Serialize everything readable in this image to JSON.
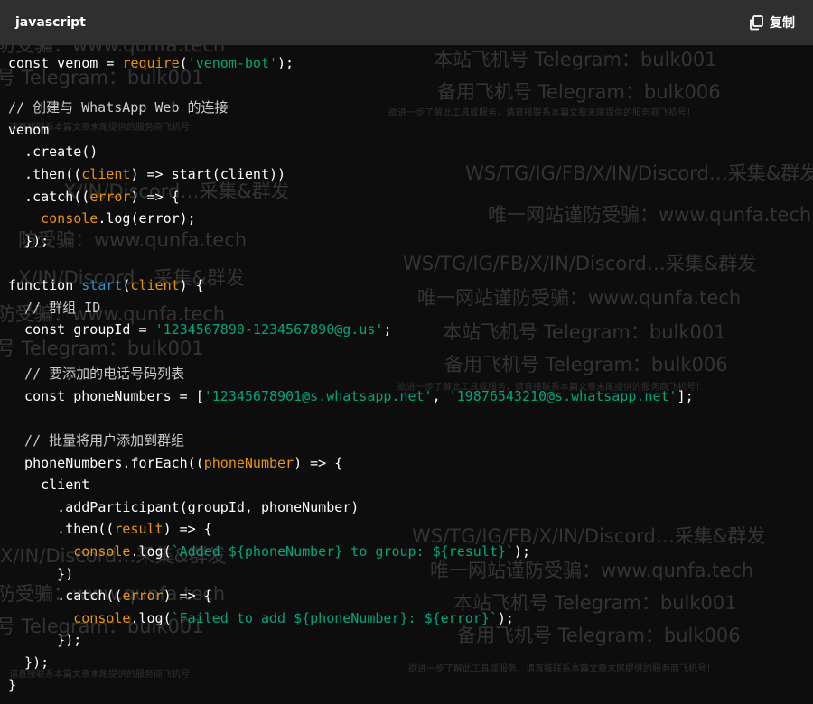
{
  "header": {
    "language": "javascript",
    "copy_label": "复制",
    "copy_icon": "copy-icon"
  },
  "colors": {
    "string": "#00a67d",
    "function": "#e9950c",
    "call": "#2e95d3",
    "comment": "#cccccc",
    "plain": "#ffffff",
    "background": "#0d0d0d",
    "header_background": "#2f2f2f"
  },
  "code_lines": [
    [
      [
        "k",
        "const venom = "
      ],
      [
        "f",
        "require"
      ],
      [
        "k",
        "("
      ],
      [
        "s",
        "'venom-bot'"
      ],
      [
        "k",
        ");"
      ]
    ],
    [],
    [
      [
        "c",
        "// 创建与 WhatsApp Web 的连接"
      ]
    ],
    [
      [
        "k",
        "venom"
      ]
    ],
    [
      [
        "k",
        "  .create()"
      ]
    ],
    [
      [
        "k",
        "  .then(("
      ],
      [
        "o",
        "client"
      ],
      [
        "k",
        ") => start(client))"
      ]
    ],
    [
      [
        "k",
        "  .catch(("
      ],
      [
        "o",
        "error"
      ],
      [
        "k",
        ") => {"
      ]
    ],
    [
      [
        "k",
        "    "
      ],
      [
        "f",
        "console"
      ],
      [
        "k",
        ".log(error);"
      ]
    ],
    [
      [
        "k",
        "  });"
      ]
    ],
    [],
    [
      [
        "k",
        "function "
      ],
      [
        "fn",
        "start"
      ],
      [
        "k",
        "("
      ],
      [
        "o",
        "client"
      ],
      [
        "k",
        ") {"
      ]
    ],
    [
      [
        "c",
        "  // 群组 ID"
      ]
    ],
    [
      [
        "k",
        "  const groupId = "
      ],
      [
        "s",
        "'1234567890-1234567890@g.us'"
      ],
      [
        "k",
        ";"
      ]
    ],
    [],
    [
      [
        "c",
        "  // 要添加的电话号码列表"
      ]
    ],
    [
      [
        "k",
        "  const phoneNumbers = ["
      ],
      [
        "s",
        "'12345678901@s.whatsapp.net'"
      ],
      [
        "k",
        ", "
      ],
      [
        "s",
        "'19876543210@s.whatsapp.net'"
      ],
      [
        "k",
        "];"
      ]
    ],
    [],
    [
      [
        "c",
        "  // 批量将用户添加到群组"
      ]
    ],
    [
      [
        "k",
        "  phoneNumbers.forEach(("
      ],
      [
        "o",
        "phoneNumber"
      ],
      [
        "k",
        ") => {"
      ]
    ],
    [
      [
        "k",
        "    client"
      ]
    ],
    [
      [
        "k",
        "      .addParticipant(groupId, phoneNumber)"
      ]
    ],
    [
      [
        "k",
        "      .then(("
      ],
      [
        "o",
        "result"
      ],
      [
        "k",
        ") => {"
      ]
    ],
    [
      [
        "k",
        "        "
      ],
      [
        "f",
        "console"
      ],
      [
        "k",
        ".log("
      ],
      [
        "s",
        "`Added ${phoneNumber} to group: ${result}`"
      ],
      [
        "k",
        ");"
      ]
    ],
    [
      [
        "k",
        "      })"
      ]
    ],
    [
      [
        "k",
        "      .catch(("
      ],
      [
        "o",
        "error"
      ],
      [
        "k",
        ") => {"
      ]
    ],
    [
      [
        "k",
        "        "
      ],
      [
        "f",
        "console"
      ],
      [
        "k",
        ".log("
      ],
      [
        "s",
        "`Failed to add ${phoneNumber}: ${error}`"
      ],
      [
        "k",
        ");"
      ]
    ],
    [
      [
        "k",
        "      });"
      ]
    ],
    [
      [
        "k",
        "  });"
      ]
    ],
    [
      [
        "k",
        "}"
      ]
    ]
  ],
  "watermarks": [
    "X/IN/Discord…采集&群发",
    "唯一网站谨防受骗：www.qunfa.tech",
    "本站飞机号 Telegram：bulk001",
    "备用飞机号 Telegram：bulk006",
    "欲进一步了解此工具或服务，请直接联系本篇文章末尾提供的服务商飞机号！",
    "WS/TG/IG/FB/X/IN/Discord…采集&群发",
    "防受骗：www.qunfa.tech",
    "号 Telegram：bulk001",
    "请直接联系本篇文章末尾提供的服务商飞机号！"
  ]
}
